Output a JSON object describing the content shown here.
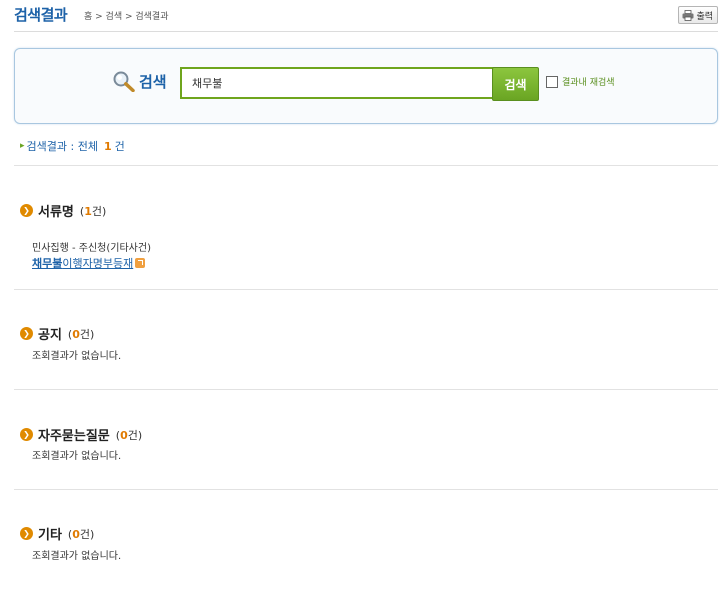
{
  "header": {
    "title": "검색결과",
    "breadcrumb": "홈 > 검색 > 검색결과",
    "print_label": "출력"
  },
  "search": {
    "label": "검색",
    "value": "채무불",
    "button_label": "검색",
    "research_label": "결과내 재검색"
  },
  "summary": {
    "prefix": "검색결과 : 전체",
    "count": "1",
    "suffix": "건"
  },
  "sections": [
    {
      "title": "서류명",
      "count": "1",
      "result_category": "민사집행 - 주신청(기타사건)",
      "result_link_highlight": "채무불",
      "result_link_rest": "이행자명부등재"
    },
    {
      "title": "공지",
      "count": "0",
      "empty_text": "조회결과가 없습니다."
    },
    {
      "title": "자주묻는질문",
      "count": "0",
      "empty_text": "조회결과가 없습니다."
    },
    {
      "title": "기타",
      "count": "0",
      "empty_text": "조회결과가 없습니다."
    }
  ],
  "count_open": "(",
  "count_close": "건)",
  "colors": {
    "accent_blue": "#1d62a8",
    "accent_green": "#6fa51d",
    "count_orange": "#e07a00"
  },
  "icons": {
    "search": "magnifier-icon",
    "print": "printer-icon",
    "bullet": "circle-arrow-icon",
    "external": "external-link-icon"
  }
}
